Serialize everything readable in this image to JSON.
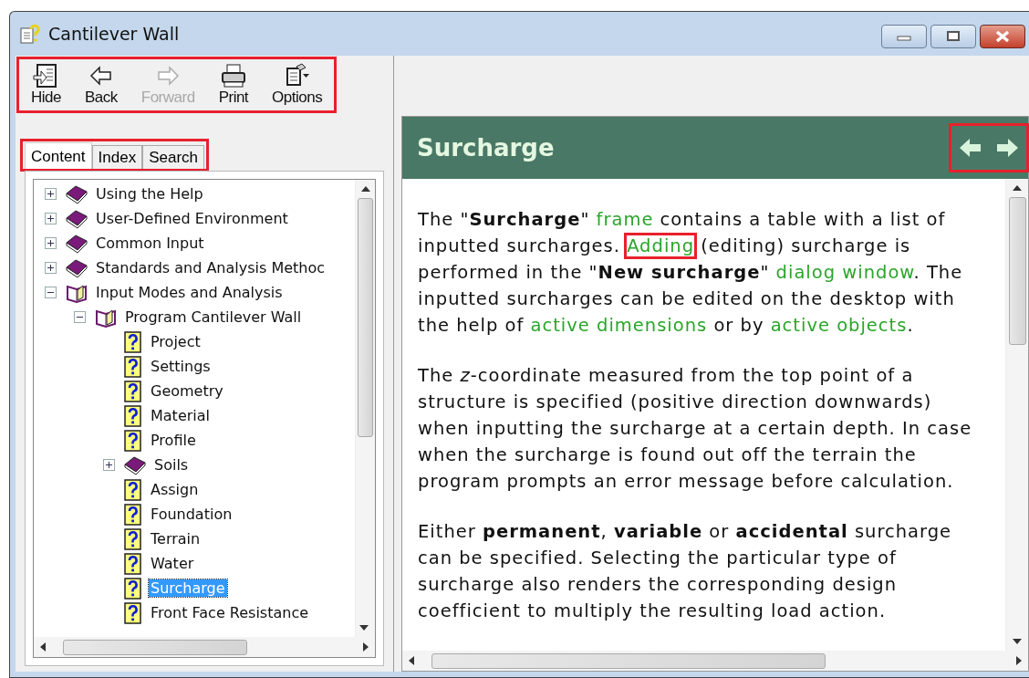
{
  "window": {
    "title": "Cantilever Wall"
  },
  "toolbar": {
    "highlighted": true,
    "buttons": [
      {
        "kind": "hide",
        "label": "Hide",
        "disabled": false
      },
      {
        "kind": "back",
        "label": "Back",
        "disabled": false
      },
      {
        "kind": "forward",
        "label": "Forward",
        "disabled": true
      },
      {
        "kind": "print",
        "label": "Print",
        "disabled": false
      },
      {
        "kind": "options",
        "label": "Options",
        "disabled": false
      }
    ]
  },
  "tabs": {
    "highlighted": true,
    "items": [
      {
        "label": "Content",
        "selected": true
      },
      {
        "label": "Index",
        "selected": false
      },
      {
        "label": "Search",
        "selected": false
      }
    ]
  },
  "tree": [
    {
      "kind": "book",
      "label": "Using the Help",
      "expanded": false,
      "selected": false
    },
    {
      "kind": "book",
      "label": "User-Defined Environment",
      "expanded": false,
      "selected": false
    },
    {
      "kind": "book",
      "label": "Common Input",
      "expanded": false,
      "selected": false
    },
    {
      "kind": "book",
      "label": "Standards and Analysis Methoc",
      "expanded": false,
      "selected": false
    },
    {
      "kind": "book",
      "label": "Input Modes and Analysis",
      "expanded": true,
      "selected": false,
      "children": [
        {
          "kind": "book",
          "label": "Program Cantilever Wall",
          "expanded": true,
          "selected": false,
          "children": [
            {
              "kind": "page",
              "label": "Project",
              "selected": false
            },
            {
              "kind": "page",
              "label": "Settings",
              "selected": false
            },
            {
              "kind": "page",
              "label": "Geometry",
              "selected": false
            },
            {
              "kind": "page",
              "label": "Material",
              "selected": false
            },
            {
              "kind": "page",
              "label": "Profile",
              "selected": false
            },
            {
              "kind": "book",
              "label": "Soils",
              "expanded": false,
              "selected": false
            },
            {
              "kind": "page",
              "label": "Assign",
              "selected": false
            },
            {
              "kind": "page",
              "label": "Foundation",
              "selected": false
            },
            {
              "kind": "page",
              "label": "Terrain",
              "selected": false
            },
            {
              "kind": "page",
              "label": "Water",
              "selected": false
            },
            {
              "kind": "page",
              "label": "Surcharge",
              "selected": true
            },
            {
              "kind": "page",
              "label": "Front Face Resistance",
              "selected": false
            }
          ]
        }
      ]
    }
  ],
  "topic": {
    "title": "Surcharge",
    "nav_highlighted": true,
    "paragraphs": [
      [
        {
          "kind": "text",
          "text": "The \""
        },
        {
          "kind": "bold",
          "text": "Surcharge"
        },
        {
          "kind": "text",
          "text": "\" "
        },
        {
          "kind": "link",
          "text": "frame",
          "highlighted": false
        },
        {
          "kind": "text",
          "text": " contains a table with a list of inputted surcharges. "
        },
        {
          "kind": "link",
          "text": "Adding",
          "highlighted": true
        },
        {
          "kind": "text",
          "text": " (editing) surcharge is performed in the \""
        },
        {
          "kind": "bold",
          "text": "New surcharge"
        },
        {
          "kind": "text",
          "text": "\" "
        },
        {
          "kind": "link",
          "text": "dialog window",
          "highlighted": false
        },
        {
          "kind": "text",
          "text": ". The inputted surcharges can be edited on the desktop with the help of "
        },
        {
          "kind": "link",
          "text": "active dimensions",
          "highlighted": false
        },
        {
          "kind": "text",
          "text": " or by "
        },
        {
          "kind": "link",
          "text": "active objects",
          "highlighted": false
        },
        {
          "kind": "text",
          "text": "."
        }
      ],
      [
        {
          "kind": "text",
          "text": "The "
        },
        {
          "kind": "italic",
          "text": "z"
        },
        {
          "kind": "text",
          "text": "-coordinate measured from the top point of a structure is specified (positive direction downwards) when inputting the surcharge at a certain depth. In case when the surcharge is found out off the terrain the program prompts an error message before calculation."
        }
      ],
      [
        {
          "kind": "text",
          "text": "Either "
        },
        {
          "kind": "bold",
          "text": "permanent"
        },
        {
          "kind": "text",
          "text": ", "
        },
        {
          "kind": "bold",
          "text": "variable"
        },
        {
          "kind": "text",
          "text": " or "
        },
        {
          "kind": "bold",
          "text": "accidental"
        },
        {
          "kind": "text",
          "text": " surcharge can be specified. Selecting the particular type of surcharge also renders the corresponding design coefficient to multiply the resulting load action."
        }
      ]
    ]
  }
}
